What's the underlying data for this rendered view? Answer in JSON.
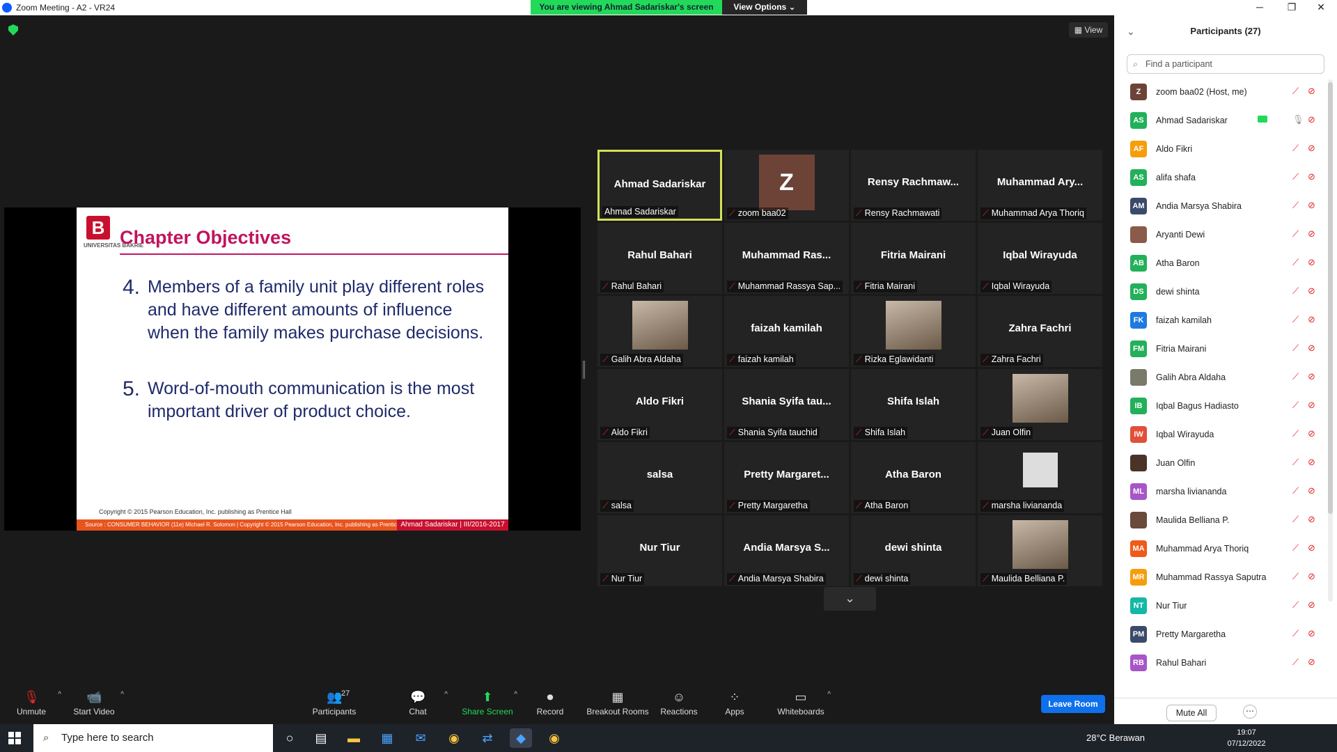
{
  "window": {
    "title": "Zoom Meeting - A2 - VR24",
    "min": "─",
    "max": "❐",
    "close": "✕"
  },
  "banner": {
    "text": "You are viewing Ahmad Sadariskar's screen",
    "view_options": "View Options ⌄"
  },
  "view_btn": "▦ View",
  "slide": {
    "logo": "B",
    "logo_text": "UNIVERSITAS BAKRIE",
    "title": "Chapter Objectives",
    "points": [
      {
        "num": "4.",
        "text": "Members of a family unit play different roles and have different amounts of influence when the family makes purchase decisions."
      },
      {
        "num": "5.",
        "text": "Word-of-mouth communication is the most important driver of product choice."
      }
    ],
    "copyright": "Copyright © 2015 Pearson Education, Inc. publishing as Prentice Hall",
    "footer_left": "Source : CONSUMER BEHAVIOR (11e)  Michael R. Solomon | Copyright © 2015 Pearson Education, Inc. publishing as Prentice Hall",
    "footer_right": "Ahmad Sadariskar | III/2016-2017"
  },
  "gallery": [
    {
      "big": "Ahmad Sadariskar",
      "label": "Ahmad Sadariskar",
      "active": true,
      "muted": false
    },
    {
      "big": "",
      "label": "zoom baa02",
      "photo": "z",
      "z": "Z",
      "muted": true
    },
    {
      "big": "Rensy Rachmaw...",
      "label": "Rensy Rachmawati",
      "muted": true
    },
    {
      "big": "Muhammad Ary...",
      "label": "Muhammad Arya Thoriq",
      "muted": true
    },
    {
      "big": "Rahul Bahari",
      "label": "Rahul Bahari",
      "muted": true
    },
    {
      "big": "Muhammad Ras...",
      "label": "Muhammad Rassya Sap...",
      "muted": true
    },
    {
      "big": "Fitria Mairani",
      "label": "Fitria Mairani",
      "muted": true
    },
    {
      "big": "Iqbal Wirayuda",
      "label": "Iqbal Wirayuda",
      "muted": true
    },
    {
      "big": "",
      "label": "Galih Abra Aldaha",
      "photo": "photo",
      "muted": true
    },
    {
      "big": "faizah kamilah",
      "label": "faizah kamilah",
      "muted": true
    },
    {
      "big": "",
      "label": "Rizka Eglawidanti",
      "photo": "photo",
      "muted": true
    },
    {
      "big": "Zahra Fachri",
      "label": "Zahra Fachri",
      "muted": true
    },
    {
      "big": "Aldo Fikri",
      "label": "Aldo Fikri",
      "muted": true
    },
    {
      "big": "Shania Syifa tau...",
      "label": "Shania Syifa tauchid",
      "muted": true
    },
    {
      "big": "Shifa Islah",
      "label": "Shifa Islah",
      "muted": true
    },
    {
      "big": "",
      "label": "Juan Olfin",
      "photo": "photo",
      "muted": true
    },
    {
      "big": "salsa",
      "label": "salsa",
      "muted": true
    },
    {
      "big": "Pretty Margaret...",
      "label": "Pretty Margaretha",
      "muted": true
    },
    {
      "big": "Atha Baron",
      "label": "Atha Baron",
      "muted": true
    },
    {
      "big": "",
      "label": "marsha livianandа",
      "photo": "avatar",
      "muted": true
    },
    {
      "big": "Nur Tiur",
      "label": "Nur Tiur",
      "muted": true
    },
    {
      "big": "Andia Marsya S...",
      "label": "Andia Marsya Shabira",
      "muted": true
    },
    {
      "big": "dewi shinta",
      "label": "dewi shinta",
      "muted": true
    },
    {
      "big": "",
      "label": "Maulida Belliana P.",
      "photo": "photo",
      "muted": true
    }
  ],
  "pagedown": "⌄",
  "toolbar": {
    "items": [
      {
        "label": "Unmute",
        "icon": "🎙"
      },
      {
        "label": "Start Video",
        "icon": "📹"
      },
      {
        "label": "Participants",
        "icon": "👥",
        "count": "27"
      },
      {
        "label": "Chat",
        "icon": "💬"
      },
      {
        "label": "Share Screen",
        "icon": "⬆"
      },
      {
        "label": "Record",
        "icon": "⏺"
      },
      {
        "label": "Breakout Rooms",
        "icon": "▦"
      },
      {
        "label": "Reactions",
        "icon": "☺"
      },
      {
        "label": "Apps",
        "icon": "⁘"
      },
      {
        "label": "Whiteboards",
        "icon": "▭"
      }
    ],
    "leave": "Leave Room"
  },
  "panel": {
    "title": "Participants (27)",
    "search_placeholder": "Find a participant",
    "mute_all": "Mute All",
    "more": "⋯",
    "participants": [
      {
        "initials": "Z",
        "name": "zoom baa02 (Host, me)",
        "color": "#6d4338"
      },
      {
        "initials": "AS",
        "name": "Ahmad Sadariskar",
        "color": "#23b05a",
        "sharing": true
      },
      {
        "initials": "AF",
        "name": "Aldo Fikri",
        "color": "#f59e0b"
      },
      {
        "initials": "AS",
        "name": "alifa shafa",
        "color": "#23b05a"
      },
      {
        "initials": "AM",
        "name": "Andia Marsya Shabira",
        "color": "#3a4a6b"
      },
      {
        "initials": "",
        "name": "Aryanti Dewi",
        "color": "#8a5a4a"
      },
      {
        "initials": "AB",
        "name": "Atha Baron",
        "color": "#23b05a"
      },
      {
        "initials": "DS",
        "name": "dewi shinta",
        "color": "#23b05a"
      },
      {
        "initials": "FK",
        "name": "faizah kamilah",
        "color": "#1f7ae0"
      },
      {
        "initials": "FM",
        "name": "Fitria Mairani",
        "color": "#23b05a"
      },
      {
        "initials": "",
        "name": "Galih Abra Aldaha",
        "color": "#7a7a6a"
      },
      {
        "initials": "IB",
        "name": "Iqbal Bagus Hadiasto",
        "color": "#23b05a"
      },
      {
        "initials": "IW",
        "name": "Iqbal Wirayuda",
        "color": "#e0503a"
      },
      {
        "initials": "",
        "name": "Juan Olfin",
        "color": "#4a3428"
      },
      {
        "initials": "ML",
        "name": "marsha livianandа",
        "color": "#a855c7"
      },
      {
        "initials": "",
        "name": "Maulida Belliana P.",
        "color": "#6a4a3a"
      },
      {
        "initials": "MA",
        "name": "Muhammad Arya Thoriq",
        "color": "#f05a1a"
      },
      {
        "initials": "MR",
        "name": "Muhammad Rassya Saputra",
        "color": "#f59e0b"
      },
      {
        "initials": "NT",
        "name": "Nur Tiur",
        "color": "#14b8a6"
      },
      {
        "initials": "PM",
        "name": "Pretty Margaretha",
        "color": "#3a4a6b"
      },
      {
        "initials": "RB",
        "name": "Rahul Bahari",
        "color": "#a855c7"
      }
    ]
  },
  "taskbar": {
    "search": "Type here to search",
    "weather": "28°C  Berawan",
    "time": "19:07",
    "date": "07/12/2022"
  }
}
